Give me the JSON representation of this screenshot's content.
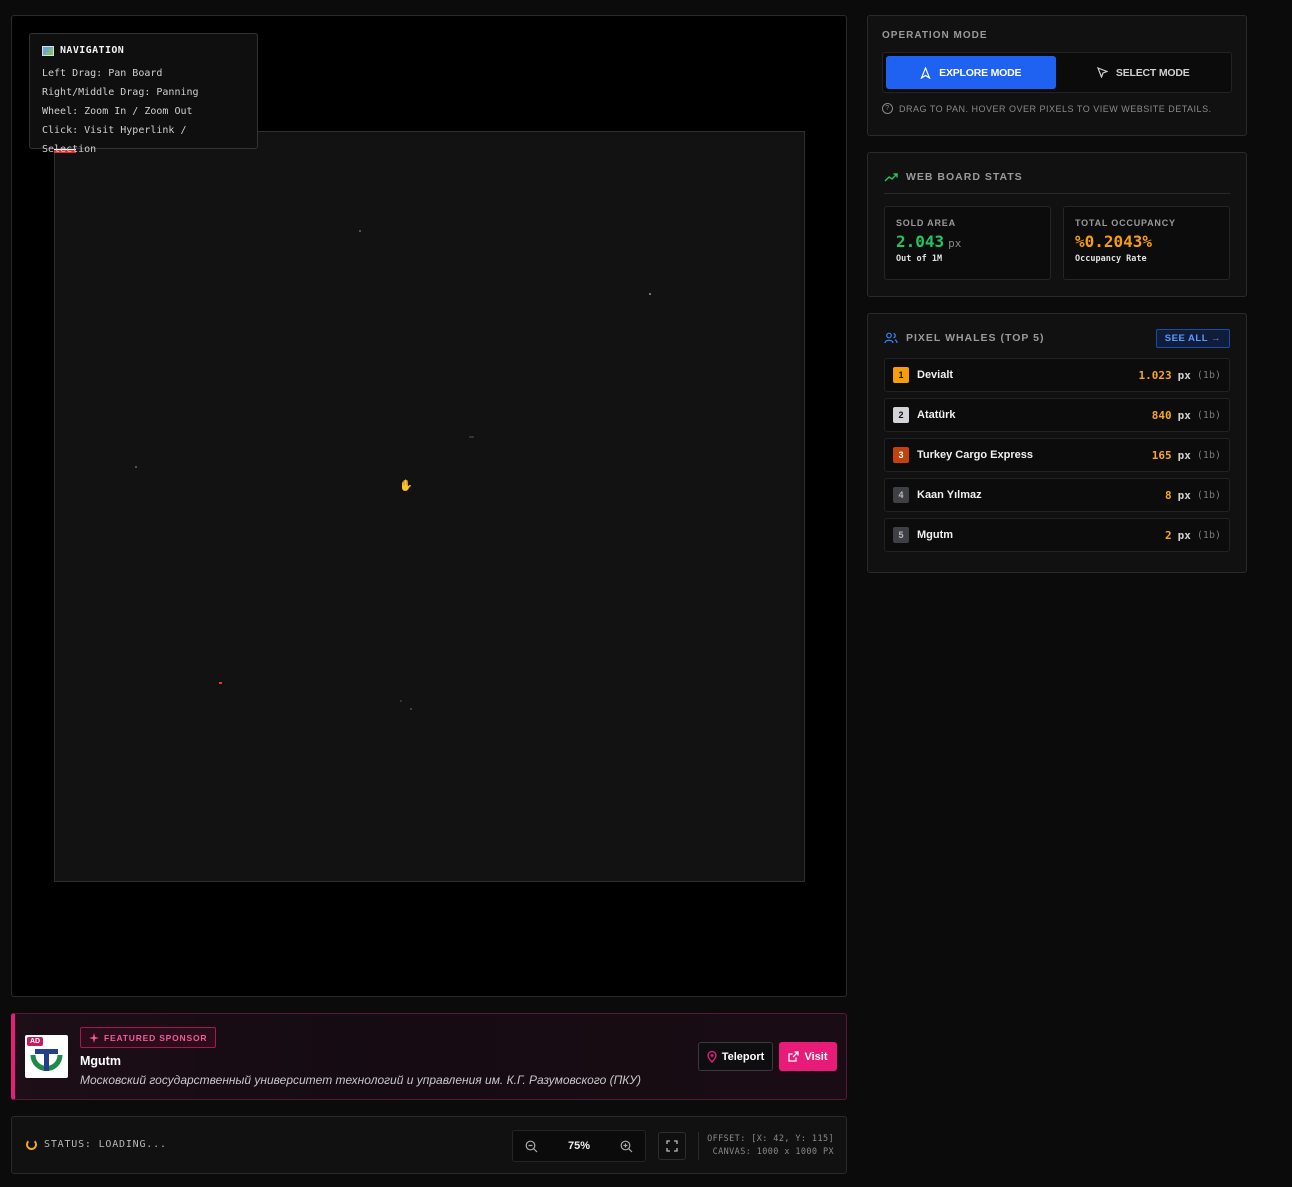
{
  "navigation_help": {
    "title": "NAVIGATION",
    "lines": [
      "Left Drag: Pan Board",
      "Right/Middle Drag: Panning",
      "Wheel: Zoom In / Zoom Out",
      "Click: Visit Hyperlink / Selection"
    ]
  },
  "operation_mode": {
    "label": "OPERATION MODE",
    "explore_label": "EXPLORE MODE",
    "select_label": "SELECT MODE",
    "active": "explore",
    "hint": "DRAG TO PAN. HOVER OVER PIXELS TO VIEW WEBSITE DETAILS."
  },
  "stats": {
    "title": "WEB BOARD STATS",
    "sold_label": "SOLD AREA",
    "sold_value": "2.043",
    "sold_unit": "px",
    "sold_sub": "Out of 1M",
    "occupancy_label": "TOTAL OCCUPANCY",
    "occupancy_value": "%0.2043%",
    "occupancy_sub": "Occupancy Rate",
    "colors": {
      "sold": "#22c55e",
      "occupancy": "#f59e0b"
    }
  },
  "whales": {
    "title": "PIXEL WHALES (TOP 5)",
    "see_all": "SEE ALL →",
    "items": [
      {
        "rank": "1",
        "name": "Devialt",
        "amount": "1.023",
        "unit": "px",
        "tag": "(1b)",
        "rank_color": "#f59e0b"
      },
      {
        "rank": "2",
        "name": "Atatürk",
        "amount": "840",
        "unit": "px",
        "tag": "(1b)",
        "rank_color": "#d4d4d8"
      },
      {
        "rank": "3",
        "name": "Turkey Cargo Express",
        "amount": "165",
        "unit": "px",
        "tag": "(1b)",
        "rank_color": "#c2410c"
      },
      {
        "rank": "4",
        "name": "Kaan Yılmaz",
        "amount": "8",
        "unit": "px",
        "tag": "(1b)",
        "rank_color": "#3f3f46"
      },
      {
        "rank": "5",
        "name": "Mgutm",
        "amount": "2",
        "unit": "px",
        "tag": "(1b)",
        "rank_color": "#3f3f46"
      }
    ]
  },
  "sponsor": {
    "badge": "FEATURED SPONSOR",
    "logo_badge": "AD",
    "name": "Mgutm",
    "description": "Московский государственный университет технологий и управления им. К.Г. Разумовского (ПКУ)",
    "teleport_label": "Teleport",
    "visit_label": "Visit"
  },
  "status": {
    "text": "STATUS: LOADING...",
    "zoom": "75%",
    "offset": "OFFSET: [X: 42, Y: 115]",
    "canvas": "CANVAS: 1000 x 1000 PX"
  }
}
